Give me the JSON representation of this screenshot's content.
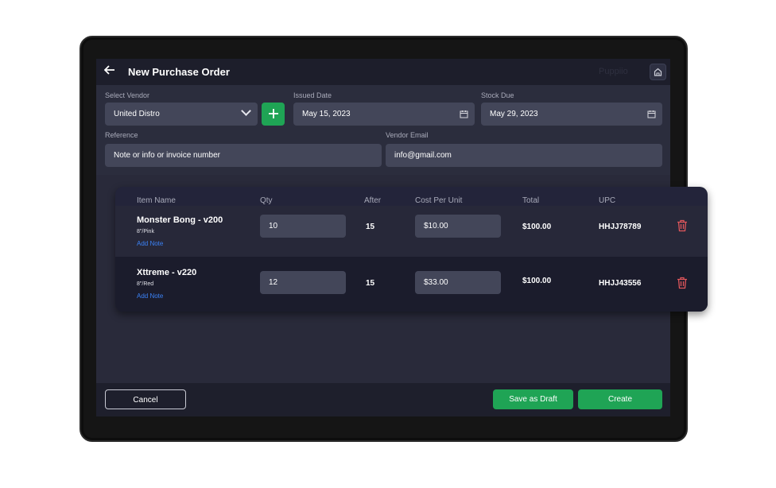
{
  "header": {
    "title": "New Purchase Order",
    "ghost_text": "Puppiio",
    "back_icon": "arrow-left-icon",
    "home_icon": "home-icon"
  },
  "form": {
    "vendor": {
      "label": "Select Vendor",
      "value": "United Distro"
    },
    "issued": {
      "label": "Issued Date",
      "value": "May 15, 2023"
    },
    "due": {
      "label": "Stock Due",
      "value": "May 29, 2023"
    },
    "reference": {
      "label": "Reference",
      "placeholder": "Note or info or invoice number"
    },
    "email": {
      "label": "Vendor Email",
      "value": "info@gmail.com"
    }
  },
  "table": {
    "columns": [
      "Item Name",
      "Qty",
      "After",
      "Cost Per Unit",
      "Total",
      "UPC"
    ],
    "rows": [
      {
        "name": "Monster Bong - v200",
        "variant": "8\"/Pink",
        "note": "Add Note",
        "qty": "10",
        "after": "15",
        "cost": "$10.00",
        "total": "$100.00",
        "upc": "HHJJ78789"
      },
      {
        "name": "Xttreme - v220",
        "variant": "8\"/Red",
        "note": "Add Note",
        "qty": "12",
        "after": "15",
        "cost": "$33.00",
        "total": "$100.00",
        "upc": "HHJJ43556"
      }
    ]
  },
  "footer": {
    "cancel": "Cancel",
    "draft": "Save as Draft",
    "create": "Create"
  },
  "colors": {
    "accent_green": "#1fa455",
    "link_blue": "#3b82f6",
    "delete_red": "#e0565b"
  }
}
